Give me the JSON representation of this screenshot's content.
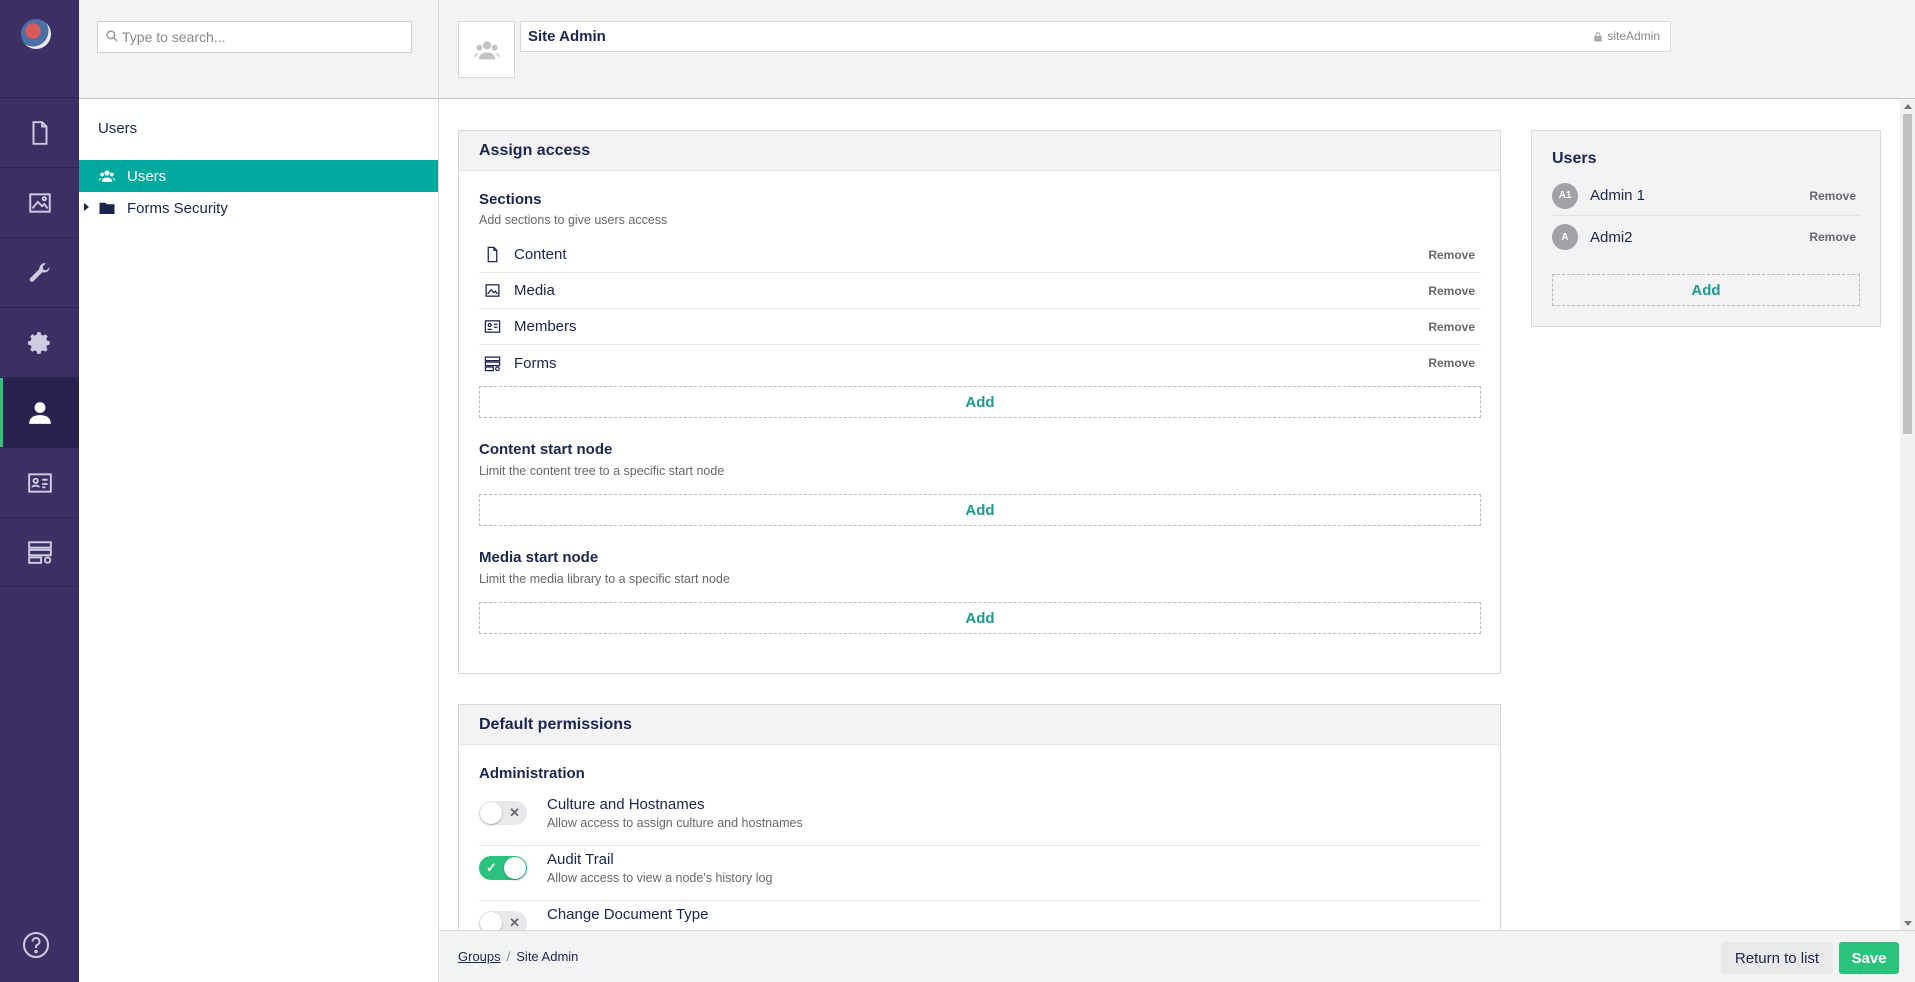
{
  "search": {
    "placeholder": "Type to search..."
  },
  "tree": {
    "title": "Users",
    "nodes": [
      {
        "label": "Users",
        "icon": "users-icon",
        "selected": true
      },
      {
        "label": "Forms Security",
        "icon": "folder-icon",
        "selected": false
      }
    ]
  },
  "rail": {
    "items": [
      "content-icon",
      "media-icon",
      "settings-wrench-icon",
      "gear-icon",
      "user-icon",
      "members-icon",
      "forms-icon"
    ],
    "active": "user-icon",
    "help": "help-icon"
  },
  "header": {
    "group_name": "Site Admin",
    "alias": "siteAdmin"
  },
  "assign_access": {
    "title": "Assign access",
    "sections": {
      "title": "Sections",
      "description": "Add sections to give users access",
      "items": [
        {
          "label": "Content",
          "icon": "document-icon",
          "remove": "Remove"
        },
        {
          "label": "Media",
          "icon": "image-icon",
          "remove": "Remove"
        },
        {
          "label": "Members",
          "icon": "id-card-icon",
          "remove": "Remove"
        },
        {
          "label": "Forms",
          "icon": "forms-icon",
          "remove": "Remove"
        }
      ],
      "add": "Add"
    },
    "content_start": {
      "title": "Content start node",
      "description": "Limit the content tree to a specific start node",
      "add": "Add"
    },
    "media_start": {
      "title": "Media start node",
      "description": "Limit the media library to a specific start node",
      "add": "Add"
    }
  },
  "default_permissions": {
    "title": "Default permissions",
    "group_title": "Administration",
    "items": [
      {
        "name": "Culture and Hostnames",
        "description": "Allow access to assign culture and hostnames",
        "enabled": false
      },
      {
        "name": "Audit Trail",
        "description": "Allow access to view a node's history log",
        "enabled": true
      },
      {
        "name": "Change Document Type",
        "description": "",
        "enabled": false
      }
    ]
  },
  "users_panel": {
    "title": "Users",
    "users": [
      {
        "initials": "A1",
        "name": "Admin 1",
        "remove": "Remove"
      },
      {
        "initials": "A",
        "name": "Admi2",
        "remove": "Remove"
      }
    ],
    "add": "Add"
  },
  "footer": {
    "breadcrumb": [
      {
        "label": "Groups"
      },
      {
        "label": "Site Admin"
      }
    ],
    "separator": "/",
    "return_label": "Return to list",
    "save_label": "Save"
  },
  "colors": {
    "rail_bg": "#3b2f63",
    "accent_teal": "#00a99d",
    "success_green": "#2bc37c"
  }
}
